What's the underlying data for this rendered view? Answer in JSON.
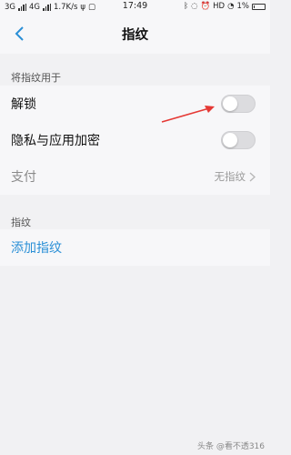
{
  "status_bar": {
    "left_text": "3G",
    "left_text2": "4G",
    "speed": "1.7K/s",
    "time": "17:49",
    "right_text": "HD",
    "battery": "1%"
  },
  "header": {
    "title": "指纹"
  },
  "section1": {
    "label": "将指纹用于",
    "rows": [
      {
        "label": "解锁"
      },
      {
        "label": "隐私与应用加密"
      },
      {
        "label": "支付",
        "value": "无指纹"
      }
    ]
  },
  "section2": {
    "label": "指纹",
    "add_label": "添加指纹"
  },
  "watermark": {
    "text": "头条 @看不透316"
  },
  "colors": {
    "accent": "#2a8fd6",
    "annotation_arrow": "#e53935"
  }
}
